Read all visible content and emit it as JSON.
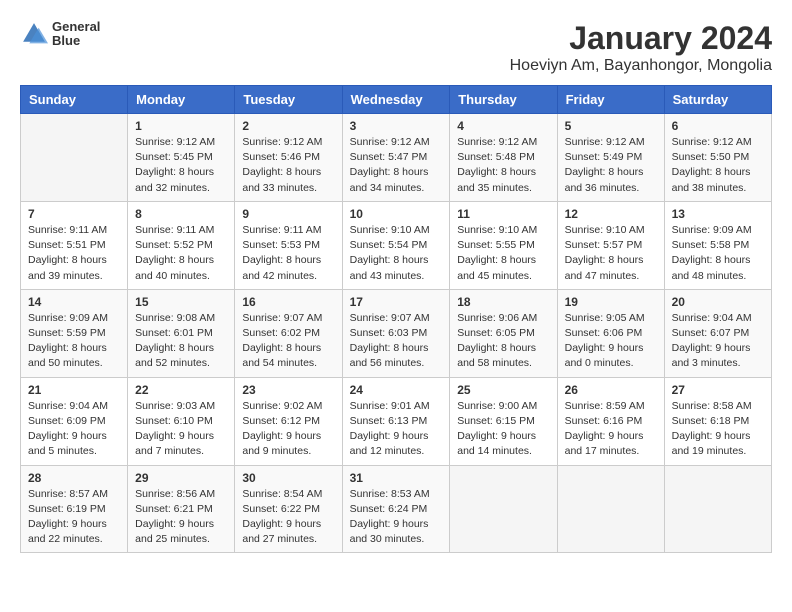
{
  "header": {
    "logo_line1": "General",
    "logo_line2": "Blue",
    "title": "January 2024",
    "subtitle": "Hoeviyn Am, Bayanhongor, Mongolia"
  },
  "weekdays": [
    "Sunday",
    "Monday",
    "Tuesday",
    "Wednesday",
    "Thursday",
    "Friday",
    "Saturday"
  ],
  "weeks": [
    [
      {
        "day": "",
        "data": ""
      },
      {
        "day": "1",
        "data": "Sunrise: 9:12 AM\nSunset: 5:45 PM\nDaylight: 8 hours\nand 32 minutes."
      },
      {
        "day": "2",
        "data": "Sunrise: 9:12 AM\nSunset: 5:46 PM\nDaylight: 8 hours\nand 33 minutes."
      },
      {
        "day": "3",
        "data": "Sunrise: 9:12 AM\nSunset: 5:47 PM\nDaylight: 8 hours\nand 34 minutes."
      },
      {
        "day": "4",
        "data": "Sunrise: 9:12 AM\nSunset: 5:48 PM\nDaylight: 8 hours\nand 35 minutes."
      },
      {
        "day": "5",
        "data": "Sunrise: 9:12 AM\nSunset: 5:49 PM\nDaylight: 8 hours\nand 36 minutes."
      },
      {
        "day": "6",
        "data": "Sunrise: 9:12 AM\nSunset: 5:50 PM\nDaylight: 8 hours\nand 38 minutes."
      }
    ],
    [
      {
        "day": "7",
        "data": "Sunrise: 9:11 AM\nSunset: 5:51 PM\nDaylight: 8 hours\nand 39 minutes."
      },
      {
        "day": "8",
        "data": "Sunrise: 9:11 AM\nSunset: 5:52 PM\nDaylight: 8 hours\nand 40 minutes."
      },
      {
        "day": "9",
        "data": "Sunrise: 9:11 AM\nSunset: 5:53 PM\nDaylight: 8 hours\nand 42 minutes."
      },
      {
        "day": "10",
        "data": "Sunrise: 9:10 AM\nSunset: 5:54 PM\nDaylight: 8 hours\nand 43 minutes."
      },
      {
        "day": "11",
        "data": "Sunrise: 9:10 AM\nSunset: 5:55 PM\nDaylight: 8 hours\nand 45 minutes."
      },
      {
        "day": "12",
        "data": "Sunrise: 9:10 AM\nSunset: 5:57 PM\nDaylight: 8 hours\nand 47 minutes."
      },
      {
        "day": "13",
        "data": "Sunrise: 9:09 AM\nSunset: 5:58 PM\nDaylight: 8 hours\nand 48 minutes."
      }
    ],
    [
      {
        "day": "14",
        "data": "Sunrise: 9:09 AM\nSunset: 5:59 PM\nDaylight: 8 hours\nand 50 minutes."
      },
      {
        "day": "15",
        "data": "Sunrise: 9:08 AM\nSunset: 6:01 PM\nDaylight: 8 hours\nand 52 minutes."
      },
      {
        "day": "16",
        "data": "Sunrise: 9:07 AM\nSunset: 6:02 PM\nDaylight: 8 hours\nand 54 minutes."
      },
      {
        "day": "17",
        "data": "Sunrise: 9:07 AM\nSunset: 6:03 PM\nDaylight: 8 hours\nand 56 minutes."
      },
      {
        "day": "18",
        "data": "Sunrise: 9:06 AM\nSunset: 6:05 PM\nDaylight: 8 hours\nand 58 minutes."
      },
      {
        "day": "19",
        "data": "Sunrise: 9:05 AM\nSunset: 6:06 PM\nDaylight: 9 hours\nand 0 minutes."
      },
      {
        "day": "20",
        "data": "Sunrise: 9:04 AM\nSunset: 6:07 PM\nDaylight: 9 hours\nand 3 minutes."
      }
    ],
    [
      {
        "day": "21",
        "data": "Sunrise: 9:04 AM\nSunset: 6:09 PM\nDaylight: 9 hours\nand 5 minutes."
      },
      {
        "day": "22",
        "data": "Sunrise: 9:03 AM\nSunset: 6:10 PM\nDaylight: 9 hours\nand 7 minutes."
      },
      {
        "day": "23",
        "data": "Sunrise: 9:02 AM\nSunset: 6:12 PM\nDaylight: 9 hours\nand 9 minutes."
      },
      {
        "day": "24",
        "data": "Sunrise: 9:01 AM\nSunset: 6:13 PM\nDaylight: 9 hours\nand 12 minutes."
      },
      {
        "day": "25",
        "data": "Sunrise: 9:00 AM\nSunset: 6:15 PM\nDaylight: 9 hours\nand 14 minutes."
      },
      {
        "day": "26",
        "data": "Sunrise: 8:59 AM\nSunset: 6:16 PM\nDaylight: 9 hours\nand 17 minutes."
      },
      {
        "day": "27",
        "data": "Sunrise: 8:58 AM\nSunset: 6:18 PM\nDaylight: 9 hours\nand 19 minutes."
      }
    ],
    [
      {
        "day": "28",
        "data": "Sunrise: 8:57 AM\nSunset: 6:19 PM\nDaylight: 9 hours\nand 22 minutes."
      },
      {
        "day": "29",
        "data": "Sunrise: 8:56 AM\nSunset: 6:21 PM\nDaylight: 9 hours\nand 25 minutes."
      },
      {
        "day": "30",
        "data": "Sunrise: 8:54 AM\nSunset: 6:22 PM\nDaylight: 9 hours\nand 27 minutes."
      },
      {
        "day": "31",
        "data": "Sunrise: 8:53 AM\nSunset: 6:24 PM\nDaylight: 9 hours\nand 30 minutes."
      },
      {
        "day": "",
        "data": ""
      },
      {
        "day": "",
        "data": ""
      },
      {
        "day": "",
        "data": ""
      }
    ]
  ]
}
